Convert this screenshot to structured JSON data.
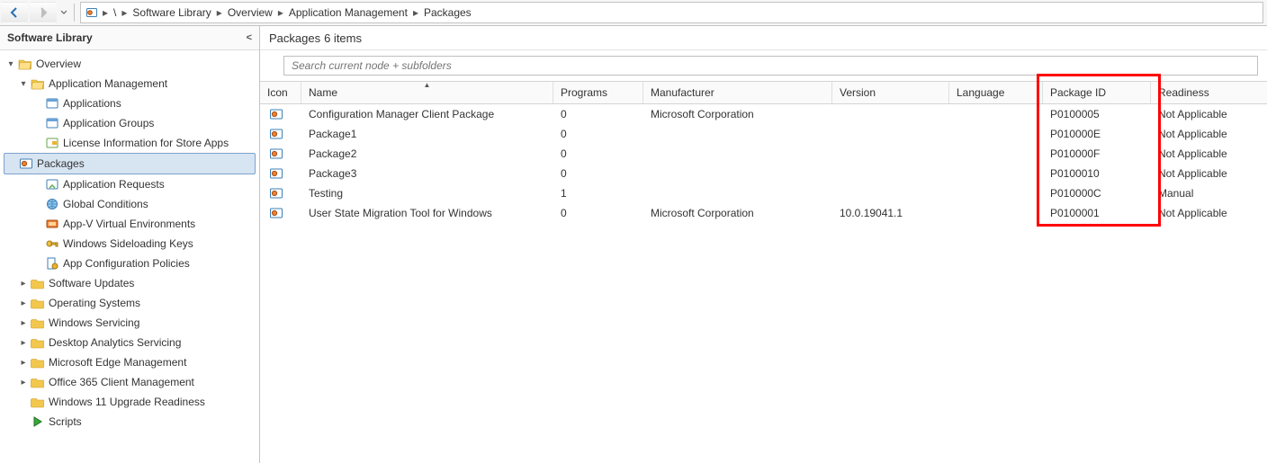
{
  "breadcrumb": {
    "segments": [
      "\\",
      "Software Library",
      "Overview",
      "Application Management",
      "Packages"
    ]
  },
  "sidebar": {
    "title": "Software Library",
    "nodes": [
      {
        "label": "Overview",
        "indent": 1,
        "twisty": "▾",
        "icon": "folder-open",
        "sel": false
      },
      {
        "label": "Application Management",
        "indent": 2,
        "twisty": "▾",
        "icon": "folder-open",
        "sel": false
      },
      {
        "label": "Applications",
        "indent": 3,
        "twisty": "",
        "icon": "app",
        "sel": false
      },
      {
        "label": "Application Groups",
        "indent": 3,
        "twisty": "",
        "icon": "app",
        "sel": false
      },
      {
        "label": "License Information for Store Apps",
        "indent": 3,
        "twisty": "",
        "icon": "license",
        "sel": false
      },
      {
        "label": "Packages",
        "indent": 3,
        "twisty": "",
        "icon": "package",
        "sel": true
      },
      {
        "label": "Application Requests",
        "indent": 3,
        "twisty": "",
        "icon": "request",
        "sel": false
      },
      {
        "label": "Global Conditions",
        "indent": 3,
        "twisty": "",
        "icon": "globe",
        "sel": false
      },
      {
        "label": "App-V Virtual Environments",
        "indent": 3,
        "twisty": "",
        "icon": "appv",
        "sel": false
      },
      {
        "label": "Windows Sideloading Keys",
        "indent": 3,
        "twisty": "",
        "icon": "key",
        "sel": false
      },
      {
        "label": "App Configuration Policies",
        "indent": 3,
        "twisty": "",
        "icon": "policy",
        "sel": false
      },
      {
        "label": "Software Updates",
        "indent": 2,
        "twisty": "▸",
        "icon": "folder",
        "sel": false
      },
      {
        "label": "Operating Systems",
        "indent": 2,
        "twisty": "▸",
        "icon": "folder",
        "sel": false
      },
      {
        "label": "Windows Servicing",
        "indent": 2,
        "twisty": "▸",
        "icon": "folder",
        "sel": false
      },
      {
        "label": "Desktop Analytics Servicing",
        "indent": 2,
        "twisty": "▸",
        "icon": "folder",
        "sel": false
      },
      {
        "label": "Microsoft Edge Management",
        "indent": 2,
        "twisty": "▸",
        "icon": "folder",
        "sel": false
      },
      {
        "label": "Office 365 Client Management",
        "indent": 2,
        "twisty": "▸",
        "icon": "folder",
        "sel": false
      },
      {
        "label": "Windows 11 Upgrade Readiness",
        "indent": 2,
        "twisty": "",
        "icon": "folder",
        "sel": false
      },
      {
        "label": "Scripts",
        "indent": 2,
        "twisty": "",
        "icon": "script",
        "sel": false
      }
    ]
  },
  "content": {
    "title_prefix": "Packages",
    "title_count": "6 items",
    "search_placeholder": "Search current node + subfolders",
    "columns": [
      "Icon",
      "Name",
      "Programs",
      "Manufacturer",
      "Version",
      "Language",
      "Package ID",
      "Readiness"
    ],
    "sort_column_index": 1,
    "rows": [
      {
        "name": "Configuration Manager Client Package",
        "programs": "0",
        "manufacturer": "Microsoft Corporation",
        "version": "",
        "language": "",
        "package_id": "P0100005",
        "readiness": "Not Applicable"
      },
      {
        "name": "Package1",
        "programs": "0",
        "manufacturer": "",
        "version": "",
        "language": "",
        "package_id": "P010000E",
        "readiness": "Not Applicable"
      },
      {
        "name": "Package2",
        "programs": "0",
        "manufacturer": "",
        "version": "",
        "language": "",
        "package_id": "P010000F",
        "readiness": "Not Applicable"
      },
      {
        "name": "Package3",
        "programs": "0",
        "manufacturer": "",
        "version": "",
        "language": "",
        "package_id": "P0100010",
        "readiness": "Not Applicable"
      },
      {
        "name": "Testing",
        "programs": "1",
        "manufacturer": "",
        "version": "",
        "language": "",
        "package_id": "P010000C",
        "readiness": "Manual"
      },
      {
        "name": "User State Migration Tool for Windows",
        "programs": "0",
        "manufacturer": "Microsoft Corporation",
        "version": "10.0.19041.1",
        "language": "",
        "package_id": "P0100001",
        "readiness": "Not Applicable"
      }
    ]
  }
}
